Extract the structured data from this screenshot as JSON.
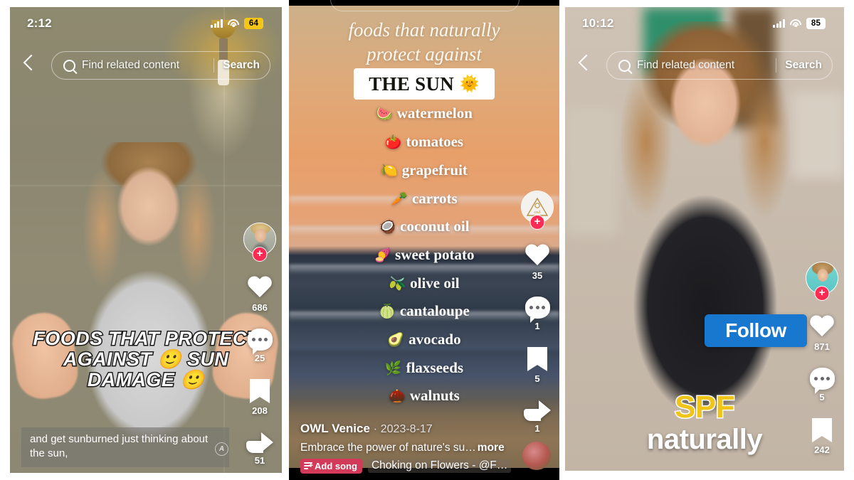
{
  "panels": [
    {
      "id": "panel-1",
      "status": {
        "time": "2:12",
        "battery": "64",
        "battery_color": "#f5c518",
        "signal_icon": "cellular-bars-icon",
        "wifi_icon": "wifi-icon"
      },
      "search": {
        "placeholder": "Find related content",
        "button": "Search",
        "back_icon": "back-chevron-icon",
        "search_icon": "search-icon"
      },
      "overlay_caption": "FOODS THAT PROTECT AGAINST 🙂 SUN DAMAGE 🙂",
      "subtitle": "and get sunburned just thinking about the sun,",
      "watermark": "A",
      "rail": [
        {
          "name": "avatar",
          "icon": "profile-avatar",
          "follow_icon": "plus-icon",
          "count": ""
        },
        {
          "name": "like",
          "icon": "heart-icon",
          "count": "686"
        },
        {
          "name": "comment",
          "icon": "comment-bubble-icon",
          "count": "25"
        },
        {
          "name": "bookmark",
          "icon": "bookmark-icon",
          "count": "208"
        },
        {
          "name": "share",
          "icon": "share-arrow-icon",
          "count": "51"
        }
      ]
    },
    {
      "id": "panel-2",
      "headline_line1": "foods that naturally",
      "headline_line2": "protect against",
      "sun_badge": {
        "text": "THE SUN",
        "emoji": "🌞"
      },
      "foods": [
        {
          "emoji": "🍉",
          "label": "watermelon"
        },
        {
          "emoji": "🍅",
          "label": "tomatoes"
        },
        {
          "emoji": "🍋",
          "label": "grapefruit"
        },
        {
          "emoji": "🥕",
          "label": "carrots"
        },
        {
          "emoji": "🥥",
          "label": "coconut oil"
        },
        {
          "emoji": "🍠",
          "label": "sweet potato"
        },
        {
          "emoji": "🫒",
          "label": "olive oil"
        },
        {
          "emoji": "🍈",
          "label": "cantaloupe"
        },
        {
          "emoji": "🥑",
          "label": "avocado"
        },
        {
          "emoji": "🌿",
          "label": "flaxseeds"
        },
        {
          "emoji": "🌰",
          "label": "walnuts"
        }
      ],
      "author": "OWL Venice",
      "separator": "·",
      "date": "2023-8-17",
      "description": "Embrace the power of nature's su…",
      "more_label": "more",
      "add_song_label": "Add song",
      "song": "Choking on Flowers - @F…",
      "rail": [
        {
          "name": "avatar",
          "icon": "owl-logo-avatar",
          "follow_icon": "plus-icon",
          "count": ""
        },
        {
          "name": "like",
          "icon": "heart-icon",
          "count": "35"
        },
        {
          "name": "comment",
          "icon": "comment-bubble-icon",
          "count": "1"
        },
        {
          "name": "bookmark",
          "icon": "bookmark-icon",
          "count": "5"
        },
        {
          "name": "share",
          "icon": "share-arrow-icon",
          "count": "1"
        }
      ]
    },
    {
      "id": "panel-3",
      "status": {
        "time": "10:12",
        "battery": "85",
        "battery_color": "#ffffff",
        "signal_icon": "cellular-bars-icon",
        "wifi_icon": "wifi-icon"
      },
      "search": {
        "placeholder": "Find related content",
        "button": "Search",
        "back_icon": "back-chevron-icon",
        "search_icon": "search-icon"
      },
      "follow_label": "Follow",
      "caption_line1": "SPF",
      "caption_line2": "naturally",
      "rail": [
        {
          "name": "avatar",
          "icon": "profile-avatar",
          "follow_icon": "plus-icon",
          "count": ""
        },
        {
          "name": "like",
          "icon": "heart-icon",
          "count": "871"
        },
        {
          "name": "comment",
          "icon": "comment-bubble-icon",
          "count": "5"
        },
        {
          "name": "bookmark",
          "icon": "bookmark-icon",
          "count": "242"
        }
      ]
    }
  ],
  "colors": {
    "accent_pink": "#fe2c55",
    "follow_blue": "#1877cf",
    "music_pill": "#d33a5a"
  }
}
